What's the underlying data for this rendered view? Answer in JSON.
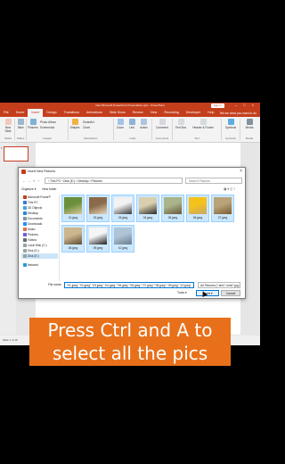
{
  "app": {
    "title": "New Microsoft PowerPoint Presentation.pptx - PowerPoint",
    "signin_label": "Sign in",
    "window_controls": "— ☐ ✕"
  },
  "ribbon": {
    "tabs": [
      {
        "label": "File"
      },
      {
        "label": "Home"
      },
      {
        "label": "Insert",
        "active": true
      },
      {
        "label": "Design"
      },
      {
        "label": "Transitions"
      },
      {
        "label": "Animations"
      },
      {
        "label": "Slide Show"
      },
      {
        "label": "Review"
      },
      {
        "label": "View"
      },
      {
        "label": "Recording"
      },
      {
        "label": "Developer"
      },
      {
        "label": "Help"
      }
    ],
    "tell_me": "Tell me what you want to do",
    "groups": {
      "slides": {
        "label": "Slides",
        "new_slide": "New Slide"
      },
      "tables": {
        "label": "Tables",
        "table": "Table"
      },
      "images": {
        "label": "Images",
        "pictures": "Pictures",
        "photo_album": "Photo Album",
        "screenshot": "Screenshot"
      },
      "illustrations": {
        "label": "Illustrations",
        "shapes": "Shapes",
        "smartart": "SmartArt",
        "chart": "Chart"
      },
      "links": {
        "label": "Links",
        "zoom": "Zoom",
        "link": "Link",
        "action": "Action"
      },
      "comments": {
        "label": "Comments",
        "comment": "Comment"
      },
      "text": {
        "label": "Text",
        "text_box": "Text Box",
        "header_footer": "Header & Footer"
      },
      "symbols": {
        "label": "Symbols",
        "symbols": "Symbols"
      },
      "media": {
        "label": "Media",
        "media": "Media"
      }
    }
  },
  "slides_panel": {
    "slide_number": "1"
  },
  "statusbar": {
    "text": "Slide 1 of 15"
  },
  "dialog": {
    "title": "Insert New Pictures",
    "path": "› This PC › Disk (E:) › Desktop › Pictures",
    "search_placeholder": "Search Pictures",
    "toolbar": {
      "organize": "Organize ▾",
      "new_folder": "New folder"
    },
    "nav_items": [
      {
        "label": "Microsoft PowerP",
        "color": "#c43e1c"
      },
      {
        "label": "This PC",
        "color": "#3a7bd5"
      },
      {
        "label": "3D Objects",
        "color": "#4aa3df"
      },
      {
        "label": "Desktop",
        "color": "#2e86de"
      },
      {
        "label": "Documents",
        "color": "#8395a7"
      },
      {
        "label": "Downloads",
        "color": "#1e90ff"
      },
      {
        "label": "Music",
        "color": "#e17055"
      },
      {
        "label": "Pictures",
        "color": "#6c5ce7"
      },
      {
        "label": "Videos",
        "color": "#636e72"
      },
      {
        "label": "Local Disk (C:)",
        "color": "#95a5a6"
      },
      {
        "label": "Disk (D:)",
        "color": "#95a5a6"
      },
      {
        "label": "Disk (E:)",
        "color": "#95a5a6",
        "selected": true
      },
      {
        "label": "Network",
        "color": "#2d98da"
      }
    ],
    "files": [
      {
        "name": "01.jpeg",
        "colors": [
          "#6b8f3b",
          "#d9c79a"
        ]
      },
      {
        "name": "02.jpeg",
        "colors": [
          "#8a6a4a",
          "#e6d5b8"
        ]
      },
      {
        "name": "03.jpeg",
        "colors": [
          "#f2f2f2",
          "#3b3b3b"
        ]
      },
      {
        "name": "04.jpeg",
        "colors": [
          "#d9cfae",
          "#2b2b2b"
        ]
      },
      {
        "name": "05.jpeg",
        "colors": [
          "#a9b48a",
          "#6a5638"
        ]
      },
      {
        "name": "06.jpeg",
        "colors": [
          "#f4c21b",
          "#c9a86b"
        ]
      },
      {
        "name": "07.jpeg",
        "colors": [
          "#b8a37a",
          "#7a5a30"
        ]
      },
      {
        "name": "08.jpeg",
        "colors": [
          "#cbb68d",
          "#5e4b33"
        ]
      },
      {
        "name": "09.jpeg",
        "colors": [
          "#f5f5f5",
          "#1f1f1f"
        ]
      },
      {
        "name": "10.jpeg",
        "colors": [
          "#b0c4d8",
          "#6b7b8a"
        ]
      }
    ],
    "file_name_label": "File name:",
    "file_name_value": "\"01.jpeg\" \"02.jpeg\" \"03.jpeg\" \"04.jpeg\" \"05.jpeg\" \"06.jpeg\" \"07.jpeg\" \"08.jpeg\" \"09.jpeg\" \"10.jpeg\"",
    "file_type_value": "All Pictures (*.emf;*.wmf;*.jpg;",
    "tools_label": "Tools ▾",
    "insert_label": "Insert ▾",
    "cancel_label": "Cancel"
  },
  "caption": {
    "line1": "Press Ctrl and A to",
    "line2": "select all the pics"
  },
  "colors": {
    "accent": "#c43e1c",
    "caption_bg": "#e8701a",
    "selection": "#cce8ff"
  }
}
